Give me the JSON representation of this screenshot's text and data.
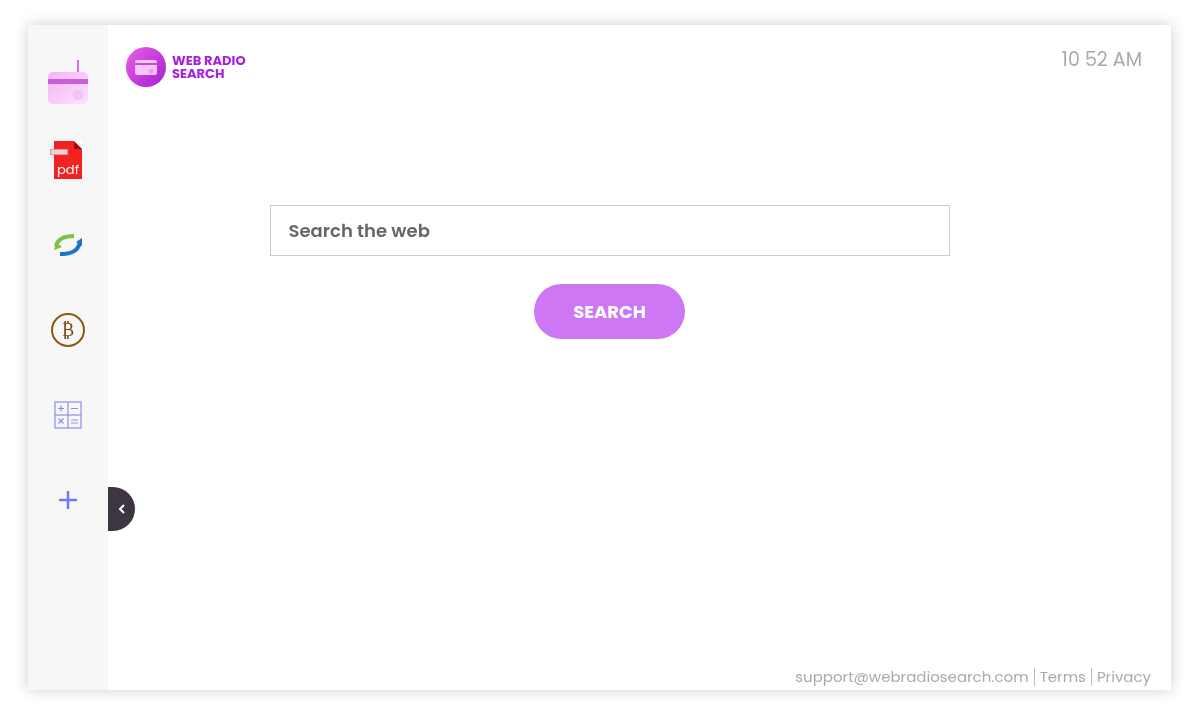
{
  "logo": {
    "text_line_1": "WEB RADIO",
    "text_line_2": "SEARCH"
  },
  "clock": "10 52 AM",
  "sidebar": {
    "items": [
      {
        "kind": "radio"
      },
      {
        "kind": "pdf",
        "label": "pdf"
      },
      {
        "kind": "convert"
      },
      {
        "kind": "bitcoin",
        "label": "₿"
      },
      {
        "kind": "calculator"
      },
      {
        "kind": "add"
      }
    ]
  },
  "search": {
    "placeholder": "Search the web",
    "button": "SEARCH"
  },
  "footer": {
    "links": [
      "support@webradiosearch.com",
      "Terms",
      "Privacy"
    ]
  }
}
